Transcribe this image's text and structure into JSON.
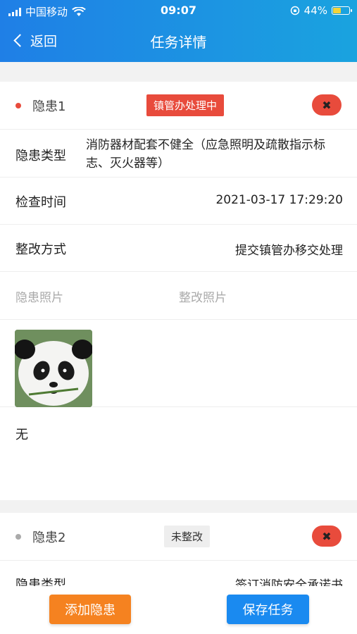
{
  "status_bar": {
    "carrier": "中国移动",
    "time": "09:07",
    "battery": "44%",
    "battery_level": 0.44
  },
  "nav": {
    "back_label": "返回",
    "title": "任务详情"
  },
  "hazard1": {
    "name": "隐患1",
    "status": "镇管办处理中",
    "delete_symbol": "✖",
    "type_label": "隐患类型",
    "type_value": "消防器材配套不健全（应急照明及疏散指示标志、灭火器等）",
    "time_label": "检查时间",
    "time_value": "2021-03-17 17:29:20",
    "method_label": "整改方式",
    "method_value": "提交镇管办移交处理",
    "photo_label": "隐患照片",
    "rectify_photo_label": "整改照片",
    "remark": "无"
  },
  "hazard2": {
    "name": "隐患2",
    "status": "未整改",
    "delete_symbol": "✖",
    "type_label_partial": "隐患类型",
    "value_partial": "签订消防安全承诺书"
  },
  "footer": {
    "add_label": "添加隐患",
    "save_label": "保存任务"
  },
  "colors": {
    "accent": "#1f7fe6",
    "danger": "#e84b3c",
    "orange": "#f58220",
    "save": "#1a8af0"
  }
}
